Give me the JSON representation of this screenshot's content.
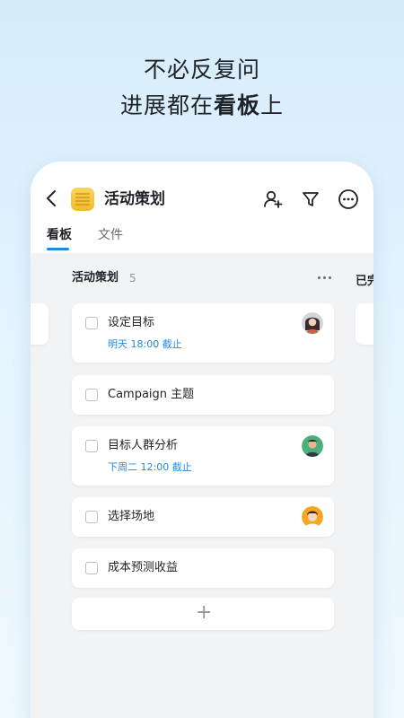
{
  "headline": {
    "line1": "不必反复问",
    "line2_prefix": "进展都在",
    "line2_bold": "看板",
    "line2_suffix": "上"
  },
  "appbar": {
    "title": "活动策划",
    "icons": [
      "back-icon",
      "project-icon",
      "add-member-icon",
      "filter-icon",
      "more-icon"
    ]
  },
  "tabs": [
    {
      "label": "看板",
      "active": true
    },
    {
      "label": "文件",
      "active": false
    }
  ],
  "column": {
    "title": "活动策划",
    "count": "5",
    "more_icon": "more-horizontal-icon"
  },
  "next_column": {
    "title_partial": "已完"
  },
  "cards": [
    {
      "title": "设定目标",
      "due": "明天 18:00 截止",
      "checked": false,
      "avatar": "avatar-girl"
    },
    {
      "title": "Campaign 主题",
      "due": "",
      "checked": false,
      "avatar": ""
    },
    {
      "title": "目标人群分析",
      "due": "下周二 12:00 截止",
      "checked": false,
      "avatar": "avatar-man"
    },
    {
      "title": "选择场地",
      "due": "",
      "checked": false,
      "avatar": "avatar-boy"
    },
    {
      "title": "成本预测收益",
      "due": "",
      "checked": false,
      "avatar": ""
    }
  ],
  "add_card_icon": "plus-icon",
  "colors": {
    "accent": "#1e88e5",
    "board_bg": "#f2f3f5",
    "page_bg_top": "#d6ecfb"
  }
}
